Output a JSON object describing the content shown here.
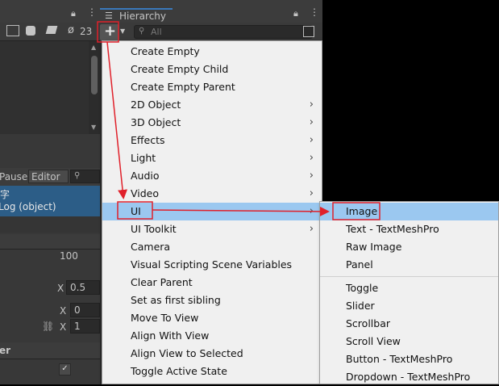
{
  "toolbar": {
    "hidden_count": "23",
    "add_button": "+"
  },
  "hierarchy": {
    "tab_label": "Hierarchy",
    "search_placeholder": "All"
  },
  "console": {
    "pause_label": "Pause",
    "editor_label": "Editor",
    "log_line1": "字",
    "log_line2": "Log (object)"
  },
  "inspector": {
    "value_100": "100",
    "x_label_1": "X",
    "x_val_1": "0.5",
    "x_label_2": "X",
    "x_val_2": "0",
    "x_label_3": "X",
    "x_val_3": "1",
    "partial_label": "er"
  },
  "create_menu": {
    "items": [
      {
        "label": "Create Empty",
        "submenu": false
      },
      {
        "label": "Create Empty Child",
        "submenu": false
      },
      {
        "label": "Create Empty Parent",
        "submenu": false
      },
      {
        "label": "2D Object",
        "submenu": true
      },
      {
        "label": "3D Object",
        "submenu": true
      },
      {
        "label": "Effects",
        "submenu": true
      },
      {
        "label": "Light",
        "submenu": true
      },
      {
        "label": "Audio",
        "submenu": true
      },
      {
        "label": "Video",
        "submenu": true
      },
      {
        "label": "UI",
        "submenu": true
      },
      {
        "label": "UI Toolkit",
        "submenu": true
      },
      {
        "label": "Camera",
        "submenu": false
      },
      {
        "label": "Visual Scripting Scene Variables",
        "submenu": false
      },
      {
        "label": "Clear Parent",
        "submenu": false
      },
      {
        "label": "Set as first sibling",
        "submenu": false
      },
      {
        "label": "Move To View",
        "submenu": false
      },
      {
        "label": "Align With View",
        "submenu": false
      },
      {
        "label": "Align View to Selected",
        "submenu": false
      },
      {
        "label": "Toggle Active State",
        "submenu": false
      }
    ],
    "selected": "UI",
    "arrow_glyph": "›"
  },
  "ui_submenu": {
    "items": [
      "Image",
      "Text - TextMeshPro",
      "Raw Image",
      "Panel",
      "Toggle",
      "Slider",
      "Scrollbar",
      "Scroll View",
      "Button - TextMeshPro",
      "Dropdown - TextMeshPro"
    ],
    "selected": "Image"
  },
  "colors": {
    "annotation_red": "#e0202a",
    "selection_blue": "#9bc8f0",
    "menu_bg": "#f0f0f0",
    "editor_dark": "#383838"
  }
}
